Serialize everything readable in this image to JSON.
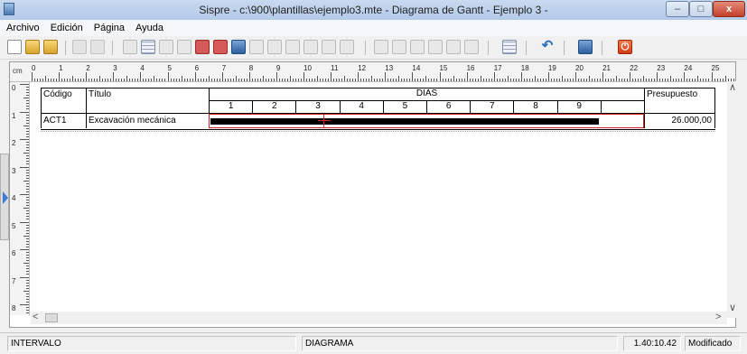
{
  "window": {
    "title": "Sispre - c:\\900\\plantillas\\ejemplo3.mte - Diagrama de Gantt - Ejemplo 3 -",
    "min_glyph": "–",
    "max_glyph": "□",
    "close_glyph": "x"
  },
  "menu": [
    "Archivo",
    "Edición",
    "Página",
    "Ayuda"
  ],
  "ruler": {
    "unit": "cm",
    "h_numbers": [
      "0",
      "1",
      "2",
      "3",
      "4",
      "5",
      "6",
      "7",
      "8",
      "9",
      "10",
      "11",
      "12",
      "13",
      "14",
      "15",
      "16",
      "17",
      "18",
      "19",
      "20",
      "21",
      "22",
      "23",
      "24",
      "25"
    ],
    "v_numbers": [
      "0",
      "1",
      "2",
      "3",
      "4",
      "5",
      "6",
      "7",
      "8"
    ]
  },
  "gantt": {
    "headers": {
      "codigo": "Código",
      "titulo": "Título",
      "dias": "DIAS",
      "presupuesto": "Presupuesto"
    },
    "days": [
      "1",
      "2",
      "3",
      "4",
      "5",
      "6",
      "7",
      "8",
      "9"
    ],
    "rows": [
      {
        "codigo": "ACT1",
        "titulo": "Excavación mecánica",
        "presupuesto": "26.000,00",
        "bar_start_day": 1,
        "bar_end_day": 9
      }
    ]
  },
  "status": {
    "intervalo": "INTERVALO",
    "diagrama": "DIAGRAMA",
    "time": "1.40:10.42",
    "state": "Modificado"
  },
  "colors": {
    "bar": "#000000",
    "selection_border": "#cc2222",
    "cursor": "#e02020"
  }
}
